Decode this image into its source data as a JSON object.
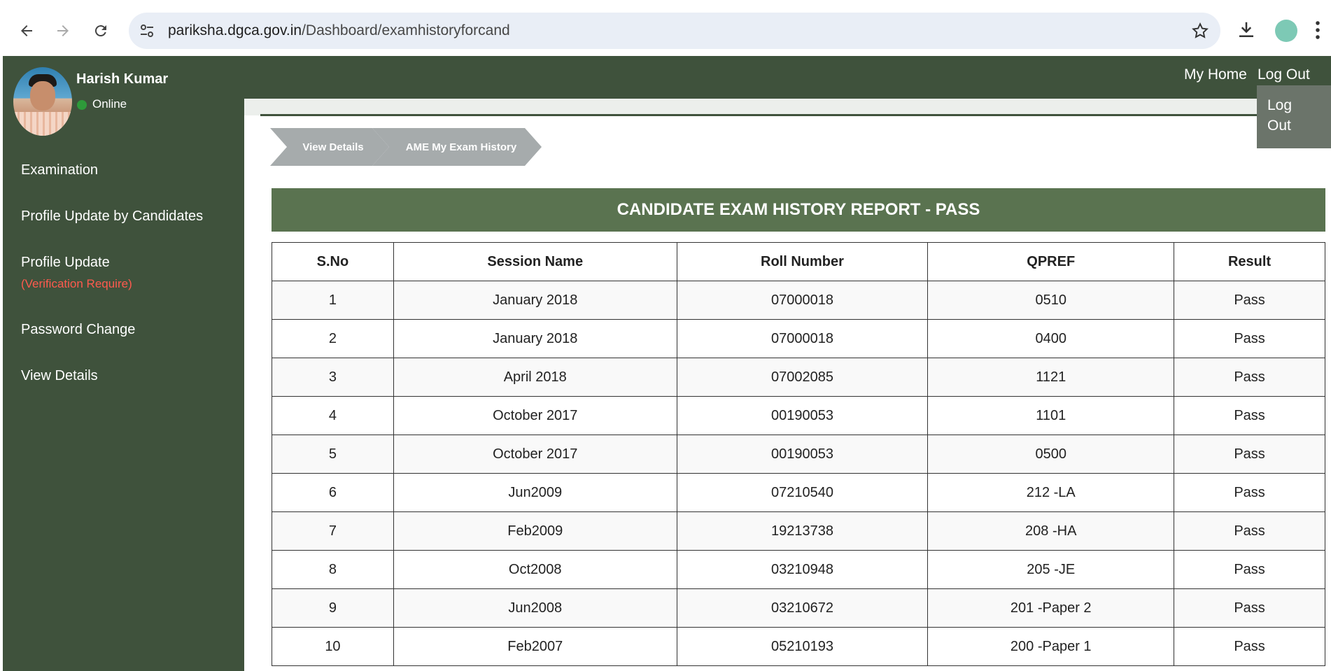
{
  "browser": {
    "url_domain": "pariksha.dgca.gov.in",
    "url_path": "/Dashboard/examhistoryforcand"
  },
  "header": {
    "my_home": "My Home",
    "log_out": "Log Out",
    "dropdown_log_out_line1": "Log",
    "dropdown_log_out_line2": "Out"
  },
  "sidebar": {
    "user_name": "Harish Kumar",
    "status": "Online",
    "items": [
      {
        "label": "Examination"
      },
      {
        "label": "Profile Update by Candidates"
      },
      {
        "label": "Profile Update",
        "sub": "(Verification Require)"
      },
      {
        "label": "Password Change"
      },
      {
        "label": "View Details"
      }
    ]
  },
  "breadcrumb": {
    "items": [
      "View Details",
      "AME My Exam History"
    ]
  },
  "report": {
    "title": "CANDIDATE EXAM HISTORY REPORT - PASS",
    "columns": [
      "S.No",
      "Session Name",
      "Roll Number",
      "QPREF",
      "Result"
    ],
    "rows": [
      [
        "1",
        "January 2018",
        "07000018",
        "0510",
        "Pass"
      ],
      [
        "2",
        "January 2018",
        "07000018",
        "0400",
        "Pass"
      ],
      [
        "3",
        "April 2018",
        "07002085",
        "1121",
        "Pass"
      ],
      [
        "4",
        "October 2017",
        "00190053",
        "1101",
        "Pass"
      ],
      [
        "5",
        "October 2017",
        "00190053",
        "0500",
        "Pass"
      ],
      [
        "6",
        "Jun2009",
        "07210540",
        "212 -LA",
        "Pass"
      ],
      [
        "7",
        "Feb2009",
        "19213738",
        "208 -HA",
        "Pass"
      ],
      [
        "8",
        "Oct2008",
        "03210948",
        "205 -JE",
        "Pass"
      ],
      [
        "9",
        "Jun2008",
        "03210672",
        "201 -Paper 2",
        "Pass"
      ],
      [
        "10",
        "Feb2007",
        "05210193",
        "200 -Paper 1",
        "Pass"
      ]
    ]
  }
}
